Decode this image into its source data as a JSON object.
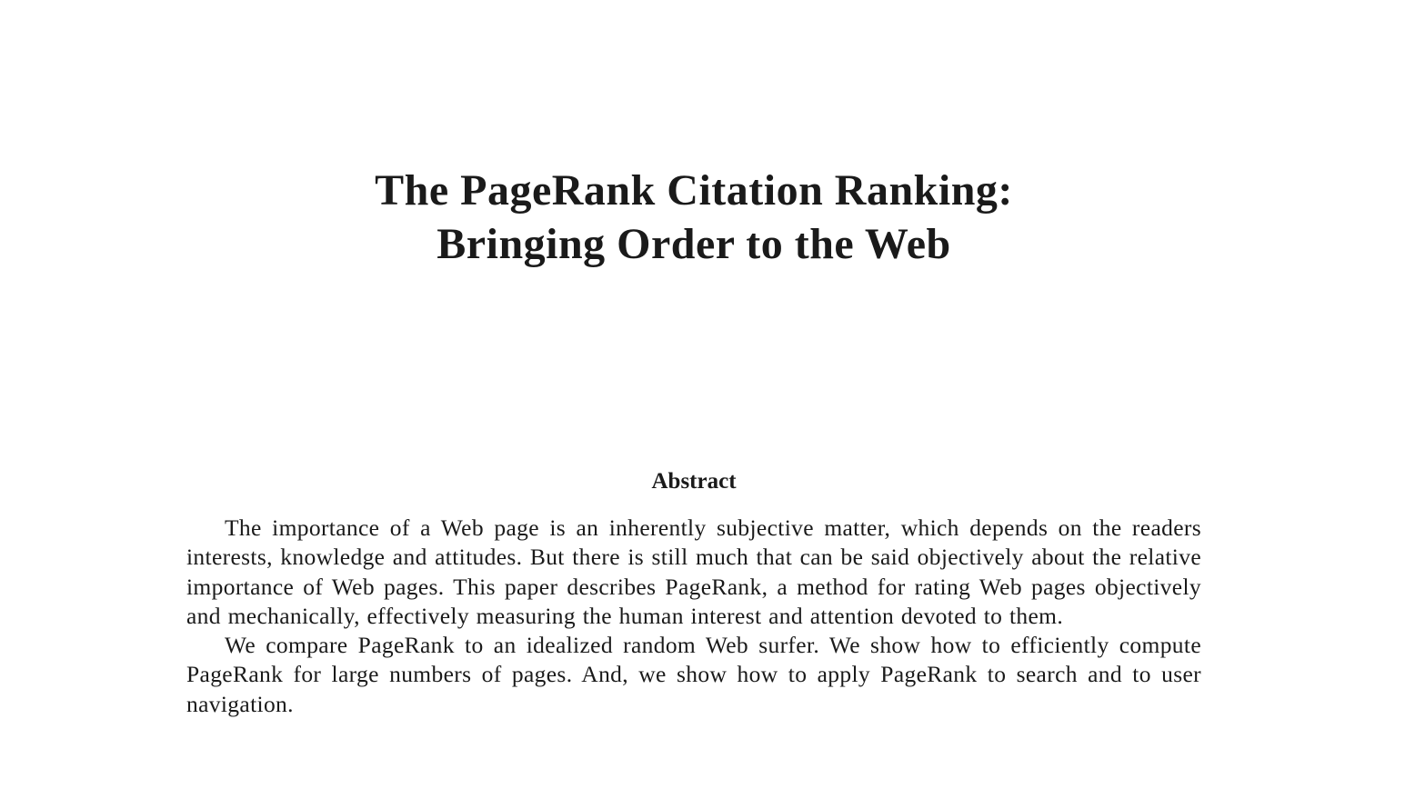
{
  "paper": {
    "title_line1": "The PageRank Citation Ranking:",
    "title_line2": "Bringing Order to the Web",
    "abstract_heading": "Abstract",
    "abstract_paragraphs": [
      "The importance of a Web page is an inherently subjective matter, which depends on the readers interests, knowledge and attitudes. But there is still much that can be said objectively about the relative importance of Web pages. This paper describes PageRank, a method for rating Web pages objectively and mechanically, effectively measuring the human interest and attention devoted to them.",
      "We compare PageRank to an idealized random Web surfer. We show how to efficiently compute PageRank for large numbers of pages. And, we show how to apply PageRank to search and to user navigation."
    ]
  }
}
